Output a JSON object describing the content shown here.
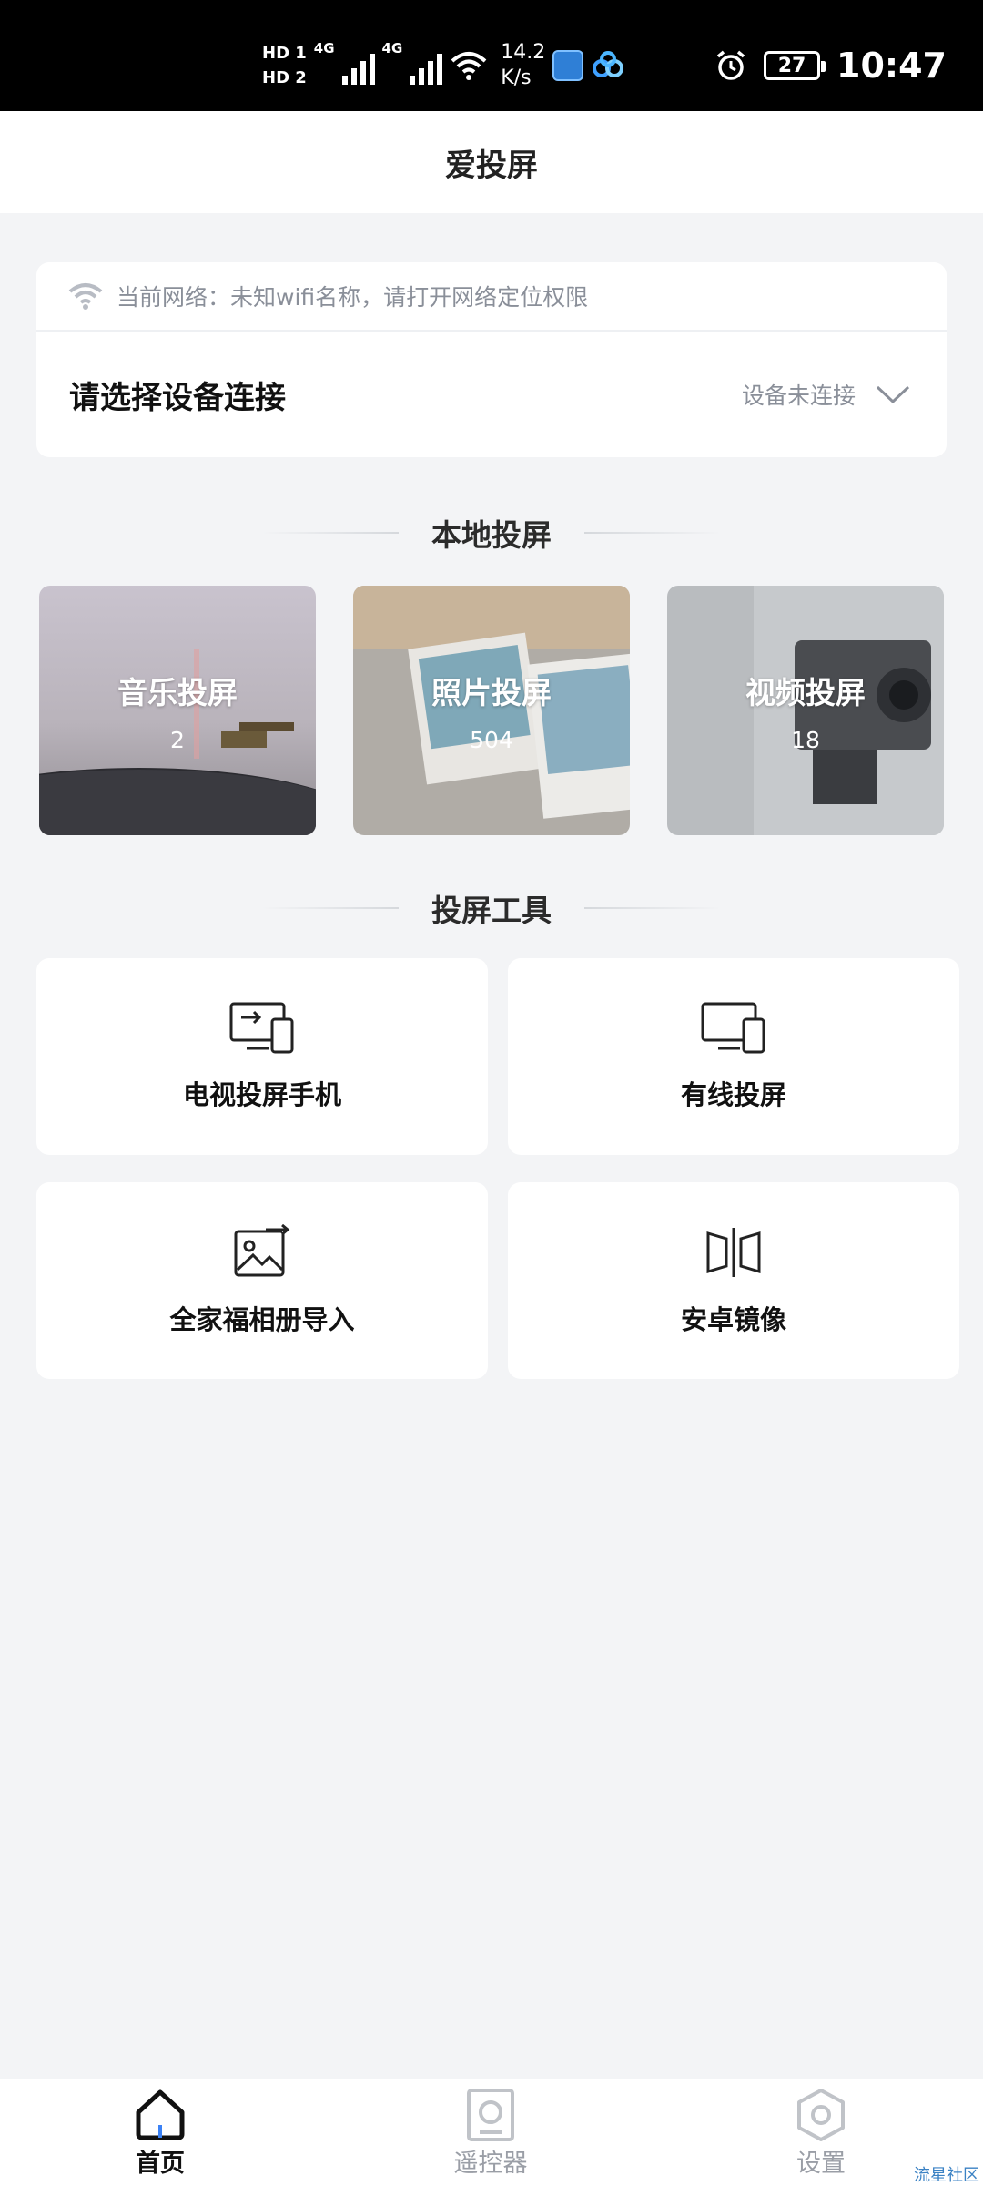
{
  "status_bar": {
    "hd1": "HD 1",
    "hd2": "HD 2",
    "net1": "4G",
    "net2": "4G",
    "speed_value": "14.2",
    "speed_unit": "K/s",
    "battery": "27",
    "time": "10:47"
  },
  "header": {
    "title": "爱投屏"
  },
  "network": {
    "info": "当前网络：未知wifi名称，请打开网络定位权限",
    "select_device": "请选择设备连接",
    "device_status": "设备未连接"
  },
  "local_section": {
    "title": "本地投屏",
    "tiles": [
      {
        "label": "音乐投屏",
        "count": "2"
      },
      {
        "label": "照片投屏",
        "count": "504"
      },
      {
        "label": "视频投屏",
        "count": "18"
      }
    ]
  },
  "tools_section": {
    "title": "投屏工具",
    "tools": [
      {
        "label": "电视投屏手机",
        "icon": "tv-to-phone-icon"
      },
      {
        "label": "有线投屏",
        "icon": "wired-cast-icon"
      },
      {
        "label": "全家福相册导入",
        "icon": "album-import-icon"
      },
      {
        "label": "安卓镜像",
        "icon": "mirror-icon"
      }
    ]
  },
  "bottom_nav": {
    "items": [
      {
        "label": "首页",
        "active": true
      },
      {
        "label": "遥控器",
        "active": false
      },
      {
        "label": "设置",
        "active": false
      }
    ]
  },
  "watermark": "流星社区",
  "colors": {
    "background": "#f3f4f6",
    "active_nav": "#111111",
    "inactive_nav": "#9a9ea6",
    "accent": "#3b82f6"
  }
}
